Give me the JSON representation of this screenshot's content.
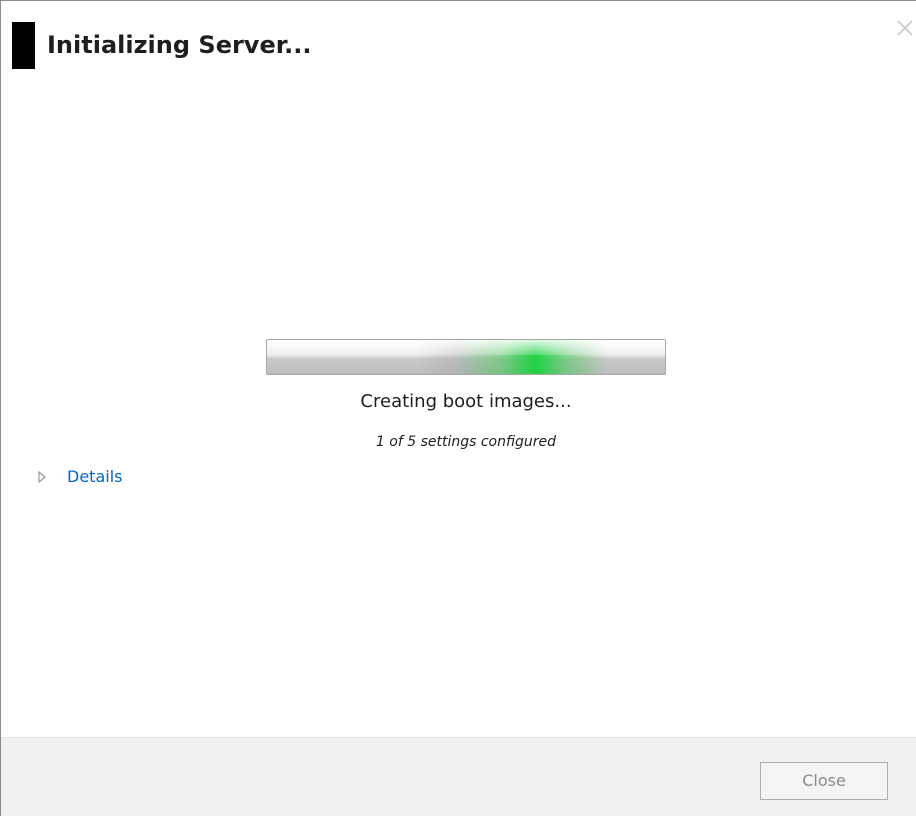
{
  "window": {
    "title": "Initializing Server...",
    "close_glyph": "close-icon"
  },
  "progress": {
    "status": "Creating boot images...",
    "sub_status": "1 of 5 settings configured",
    "mode": "indeterminate",
    "accent_color": "#1ed03c"
  },
  "details": {
    "label": "Details",
    "expanded": false,
    "arrow_icon": "triangle-right-icon",
    "link_color": "#0066cc"
  },
  "footer": {
    "close_label": "Close",
    "close_enabled": false
  }
}
